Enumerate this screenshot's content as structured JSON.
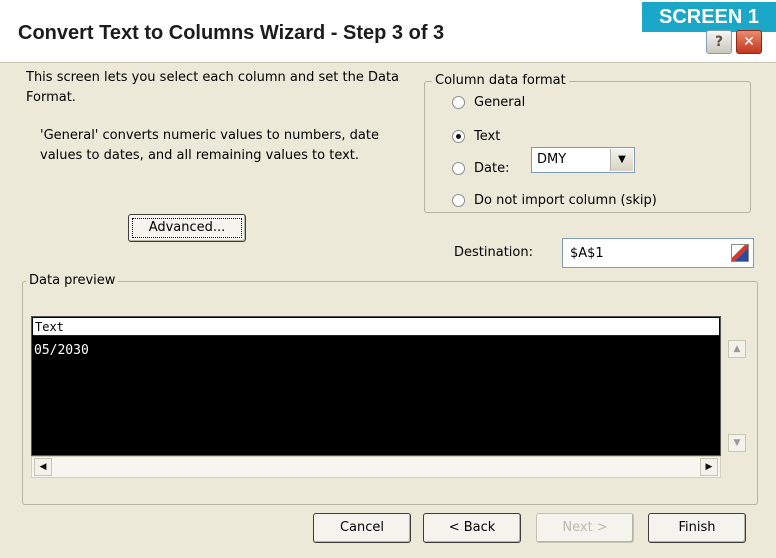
{
  "window": {
    "title": "Convert Text to Columns Wizard - Step 3 of 3",
    "badge": "SCREEN 1",
    "help_glyph": "?",
    "close_glyph": "✕"
  },
  "description": {
    "line1": "This screen lets you select each column and set the Data Format.",
    "line2": "'General' converts numeric values to numbers, date values to dates, and all remaining values to text."
  },
  "column_format": {
    "label": "Column data format",
    "options": [
      {
        "label": "General",
        "selected": false
      },
      {
        "label": "Text",
        "selected": true
      },
      {
        "label": "Date:",
        "selected": false
      },
      {
        "label": "Do not import column (skip)",
        "selected": false
      }
    ],
    "date_format": "DMY"
  },
  "advanced_label": "Advanced...",
  "destination": {
    "label": "Destination:",
    "value": "$A$1"
  },
  "preview": {
    "label": "Data preview",
    "column_header": "Text",
    "cell": "05/2030"
  },
  "buttons": {
    "cancel": "Cancel",
    "back": "< Back",
    "next": "Next >",
    "finish": "Finish"
  },
  "colors": {
    "dialog_bg": "#ece9d8",
    "badge": "#1aa7c8",
    "close": "#c2361d",
    "preview_bg": "#000000"
  }
}
